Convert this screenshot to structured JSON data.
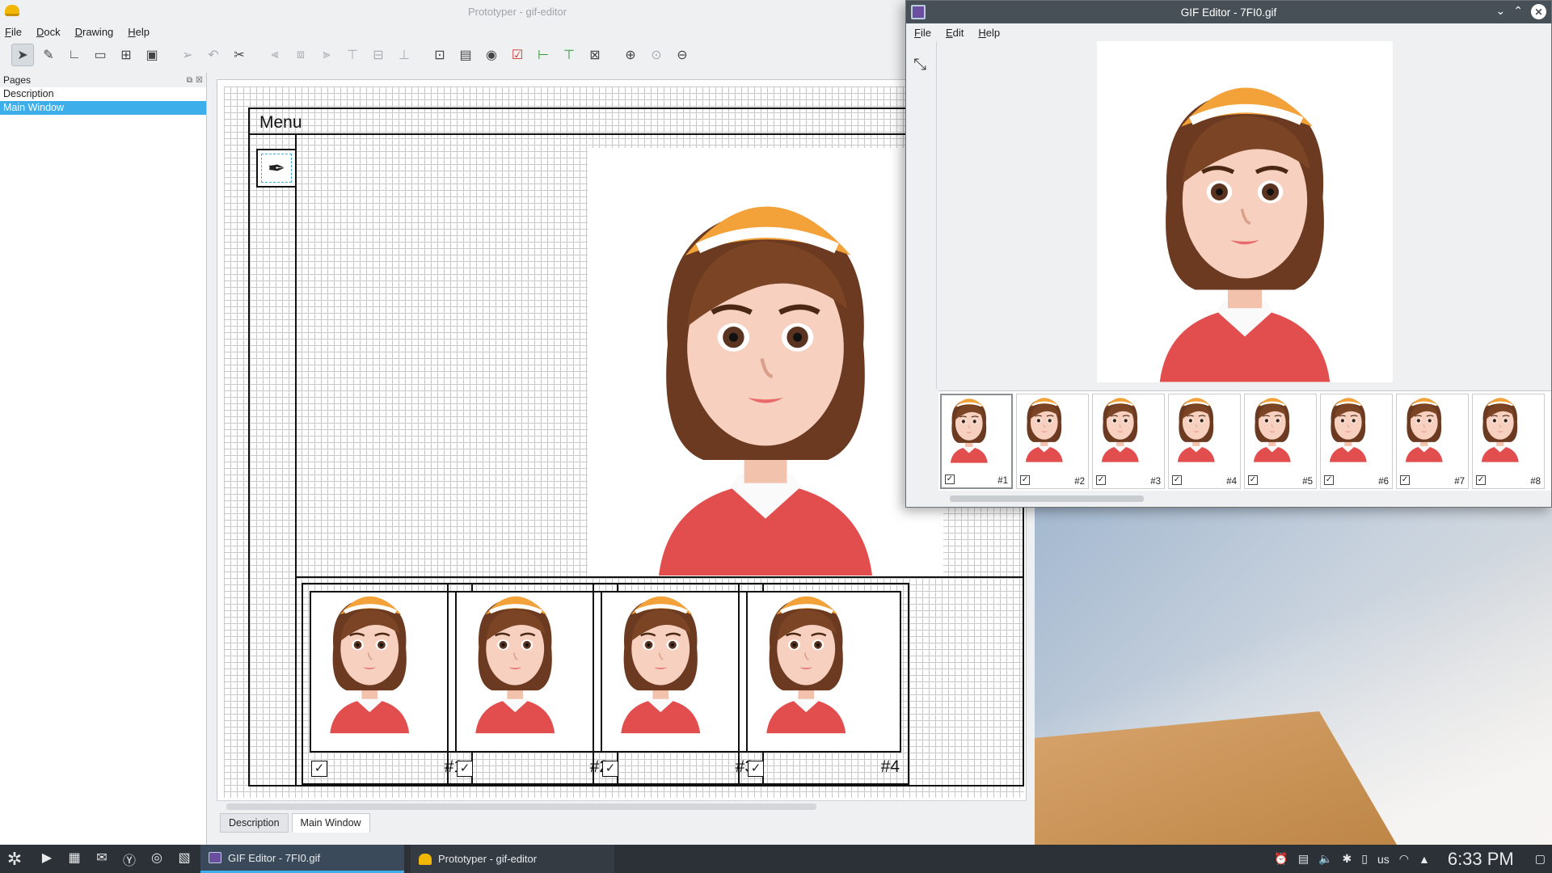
{
  "prototyper": {
    "title": "Prototyper - gif-editor",
    "menu": [
      "File",
      "Dock",
      "Drawing",
      "Help"
    ],
    "toolbar_icons": [
      "select-icon",
      "pen-icon",
      "polyline-icon",
      "rectangle-icon",
      "group-icon",
      "image-icon",
      "arrow-right-icon",
      "arrow-left-icon",
      "crop-icon",
      "align-left-icon",
      "align-hcenter-icon",
      "align-right-icon",
      "align-top-icon",
      "align-vcenter-icon",
      "align-bottom-icon",
      "ok-button-icon",
      "combobox-icon",
      "radio-icon",
      "checkbox-icon",
      "hslider-icon",
      "vslider-icon",
      "spinbox-icon",
      "zoom-in-icon",
      "zoom-original-icon",
      "zoom-out-icon"
    ],
    "pages_panel": {
      "title": "Pages",
      "items": [
        {
          "label": "Description",
          "selected": false
        },
        {
          "label": "Main Window",
          "selected": true
        }
      ]
    },
    "canvas": {
      "menu_label": "Menu",
      "frames": [
        {
          "checked": true,
          "label": "#1"
        },
        {
          "checked": true,
          "label": "#2"
        },
        {
          "checked": true,
          "label": "#3"
        },
        {
          "checked": true,
          "label": "#4"
        }
      ]
    },
    "tabs": [
      {
        "label": "Description",
        "active": false
      },
      {
        "label": "Main Window",
        "active": true
      }
    ]
  },
  "gif_editor": {
    "title": "GIF Editor - 7FI0.gif",
    "menu": [
      "File",
      "Edit",
      "Help"
    ],
    "frames": [
      {
        "label": "#1",
        "checked": true,
        "selected": true
      },
      {
        "label": "#2",
        "checked": true,
        "selected": false
      },
      {
        "label": "#3",
        "checked": true,
        "selected": false
      },
      {
        "label": "#4",
        "checked": true,
        "selected": false
      },
      {
        "label": "#5",
        "checked": true,
        "selected": false
      },
      {
        "label": "#6",
        "checked": true,
        "selected": false
      },
      {
        "label": "#7",
        "checked": true,
        "selected": false
      },
      {
        "label": "#8",
        "checked": true,
        "selected": false
      }
    ]
  },
  "taskbar": {
    "tasks": [
      {
        "label": "GIF Editor - 7FI0.gif",
        "active": true
      },
      {
        "label": "Prototyper - gif-editor",
        "active": false
      }
    ],
    "keyboard_layout": "us",
    "clock": "6:33 PM"
  },
  "colors": {
    "accent": "#3daee9",
    "titlebar": "#475057",
    "taskbar": "#2b3136"
  }
}
